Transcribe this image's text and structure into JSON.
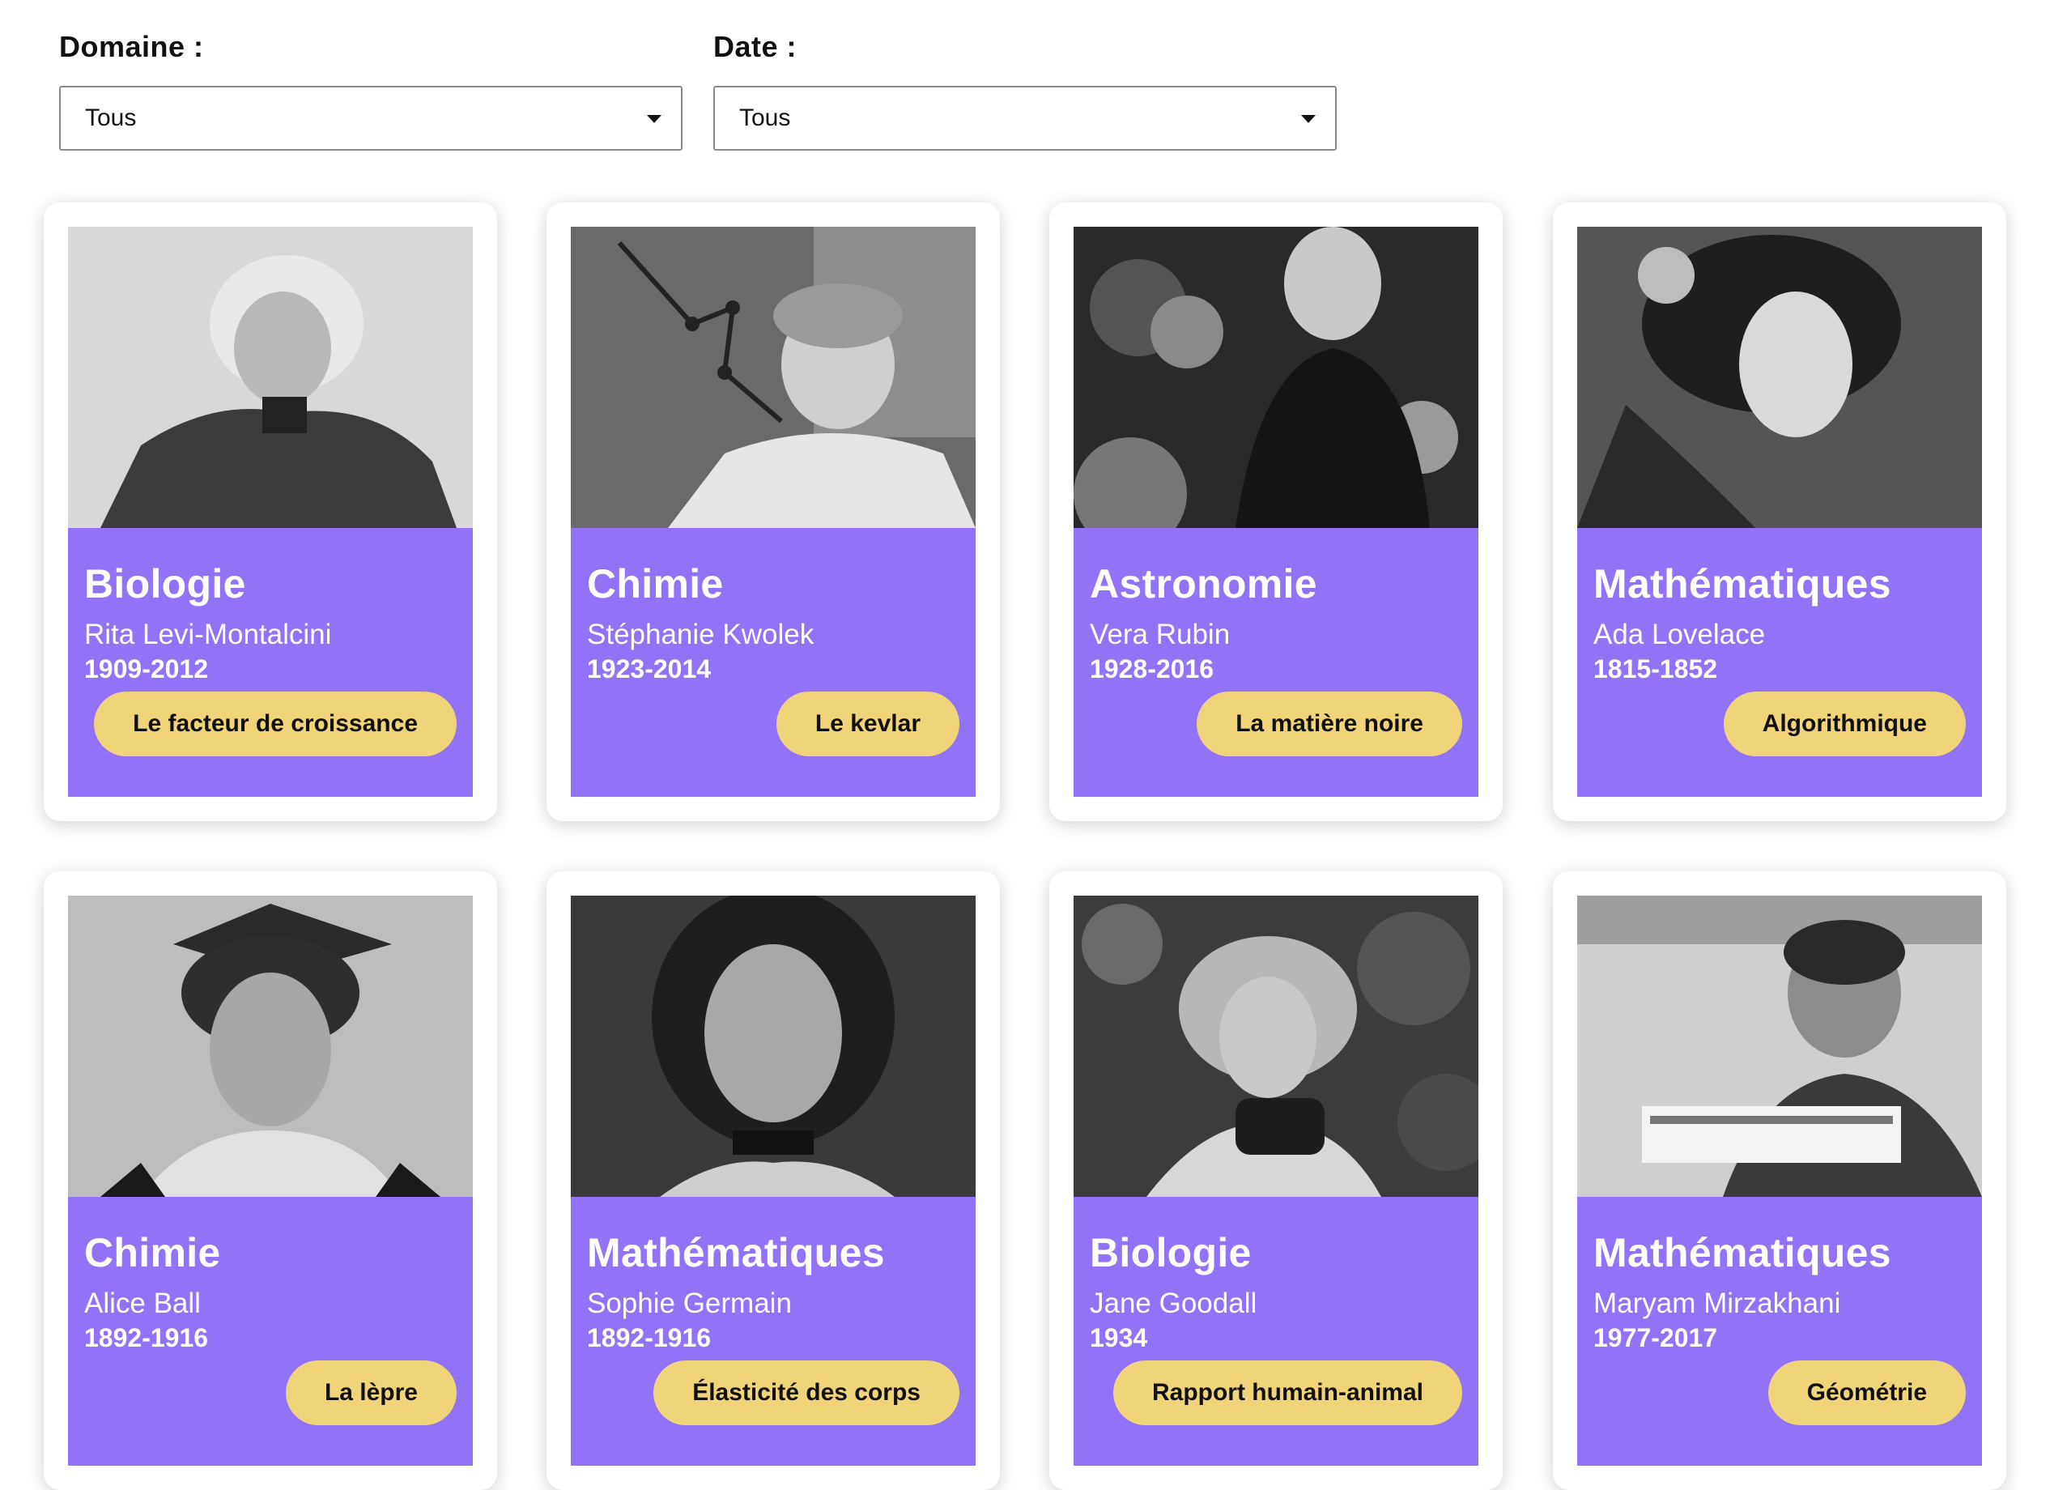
{
  "filters": {
    "domain": {
      "label": "Domaine :",
      "value": "Tous"
    },
    "date": {
      "label": "Date :",
      "value": "Tous"
    }
  },
  "cards": [
    {
      "domain": "Biologie",
      "name": "Rita Levi-Montalcini",
      "dates": "1909-2012",
      "topic": "Le facteur de croissance"
    },
    {
      "domain": "Chimie",
      "name": "Stéphanie Kwolek",
      "dates": "1923-2014",
      "topic": "Le kevlar"
    },
    {
      "domain": "Astronomie",
      "name": "Vera Rubin",
      "dates": "1928-2016",
      "topic": "La matière noire"
    },
    {
      "domain": "Mathématiques",
      "name": "Ada Lovelace",
      "dates": "1815-1852",
      "topic": "Algorithmique"
    },
    {
      "domain": "Chimie",
      "name": "Alice Ball",
      "dates": "1892-1916",
      "topic": "La lèpre"
    },
    {
      "domain": "Mathématiques",
      "name": "Sophie Germain",
      "dates": "1892-1916",
      "topic": "Élasticité des corps"
    },
    {
      "domain": "Biologie",
      "name": "Jane Goodall",
      "dates": "1934",
      "topic": "Rapport humain-animal"
    },
    {
      "domain": "Mathématiques",
      "name": "Maryam Mirzakhani",
      "dates": "1977-2017",
      "topic": "Géométrie"
    }
  ],
  "colors": {
    "card_band": "#9272f7",
    "topic_button": "#f0d47a"
  }
}
